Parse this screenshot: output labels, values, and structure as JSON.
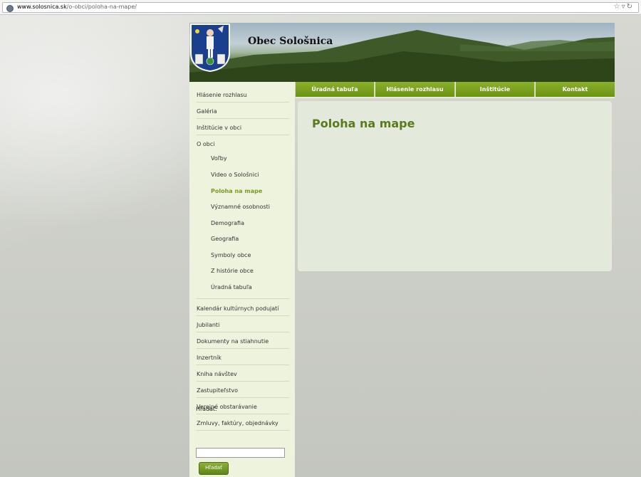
{
  "browser": {
    "url_host": "www.solosnica.sk",
    "url_path": "/o-obci/poloha-na-mape/"
  },
  "header": {
    "site_title": "Obec Sološnica"
  },
  "tabs": [
    {
      "label": "Úradná tabuľa"
    },
    {
      "label": "Hlásenie rozhlasu"
    },
    {
      "label": "Inštitúcie"
    },
    {
      "label": "Kontakt"
    }
  ],
  "sidebar": {
    "items": [
      {
        "label": "Hlásenie rozhlasu"
      },
      {
        "label": "Galéria"
      },
      {
        "label": "Inštitúcie v obci"
      },
      {
        "label": "O obci"
      }
    ],
    "sub_items": [
      {
        "label": "Voľby"
      },
      {
        "label": "Video o Sološnici"
      },
      {
        "label": "Poloha na mape"
      },
      {
        "label": "Významné osobnosti"
      },
      {
        "label": "Demografia"
      },
      {
        "label": "Geografia"
      },
      {
        "label": "Symboly obce"
      },
      {
        "label": "Z histórie obce"
      },
      {
        "label": "Úradná tabuľa"
      }
    ],
    "lower_items": [
      {
        "label": "Kalendár kultúrnych podujatí"
      },
      {
        "label": "Jubilanti"
      },
      {
        "label": "Dokumenty na stiahnutie"
      },
      {
        "label": "Inzertník"
      },
      {
        "label": "Kniha návštev"
      },
      {
        "label": "Zastupiteľstvo"
      },
      {
        "label": "Verejné obstarávanie"
      },
      {
        "label": "Zmluvy, faktúry, objednávky"
      }
    ],
    "search_label": "Hľadať:",
    "search_button": "Hľadať",
    "search_value": ""
  },
  "content": {
    "title": "Poloha na mape"
  },
  "colors": {
    "accent": "#6a9315",
    "active_link": "#7a9a1e",
    "title": "#5b7a1e"
  }
}
